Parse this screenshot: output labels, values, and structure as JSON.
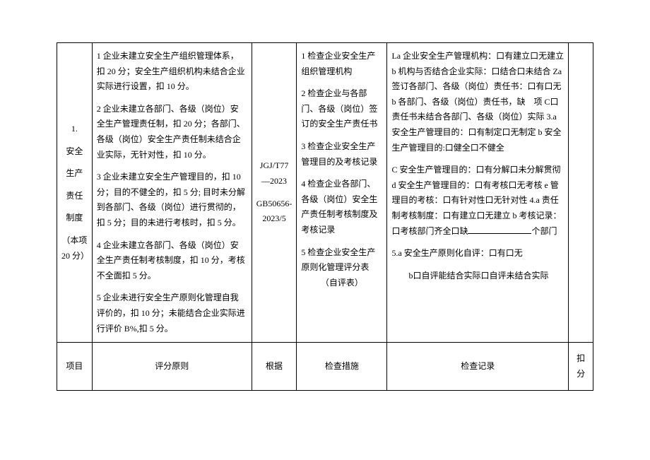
{
  "row1": {
    "col1": {
      "num": "1.",
      "title": "安全",
      "t2": "生产",
      "t3": "责任",
      "t4": "制度",
      "note": "（本项 20 分）"
    },
    "col2": {
      "p1": "1 企业未建立安全生产组织管理体系，扣 20 分；安全生产组织机构未结合企业实际进行设置，扣 10 分。",
      "p2": "2 企业未建立各部门、各级（岗位）安全生产管理责任制，扣 20 分；各部门、各级（岗位）安全生产责任制未结合企业实际，无针对性，扣 10 分。",
      "p3": "3 企业未建立安全生产管理目的，扣 10 分；目的不健全的，扣 5 分; 目时未分解到各部门、各级（岗位）进行贯彻的，扣 5 分；目的未进行考核时，扣 5 分。",
      "p4": "4 企业未建立各部门、各级（岗位）安全生产责任制考核制度，扣 10 分，考核不全面扣 5 分。",
      "p5": "5 企业未进行安全生产原则化管理自我评价的，扣 10 分；未能结合企业实际进行评价 B%,扣 5 分。"
    },
    "col3": {
      "l1": "JGJ/T77—2023",
      "l2": "GB50656-2023/5"
    },
    "col4": {
      "p1": "1 检查企业安全生产组织管理机构",
      "p2": "2 检查企业与各部门、各级（岗位）签订的安全生产责任书",
      "p3": "3 检查企业安全生产管理目的及考核记录",
      "p4": "4 检查企业各部门、各级（岗位）安全生产责任制考核制度及考核记录",
      "p5": "5 检查企业安全生产原则化管理评分表",
      "p5b": "（自评表）"
    },
    "col5": {
      "p1": "La 企业安全生产管理机构：口有建立口无建立 b 机构与否结合企业实际：口结合口未结合 Za 签订各部门、各级（岗位）责任书：口有口无 b 各部门、各级（岗位）责任书，缺　项 C口责任书未结合各部门、各级（岗位）实际 3.a 安全生产管理目的：口有制定口无制定 b 安全生产管理目的:口健全口不健全",
      "p2a": "C 安全生产管理目的：口有分解口未分解贯彻 d 安全生产管理目的：口有考核口无考核 e 管理目的考核：口有针对性口无针对性 4.a 责任制考核制度：口有建立口无建立 b 考核记录：口考核部门齐全口缺",
      "p2b": "个部门",
      "p3": "5.a 安全生产原则化自评：口有口无",
      "p4": "b口自评能结合实际口自评未结合实际"
    }
  },
  "headers": {
    "c1": "项目",
    "c2": "评分原则",
    "c3": "根据",
    "c4": "检查措施",
    "c5": "检查记录",
    "c6": "扣分"
  }
}
